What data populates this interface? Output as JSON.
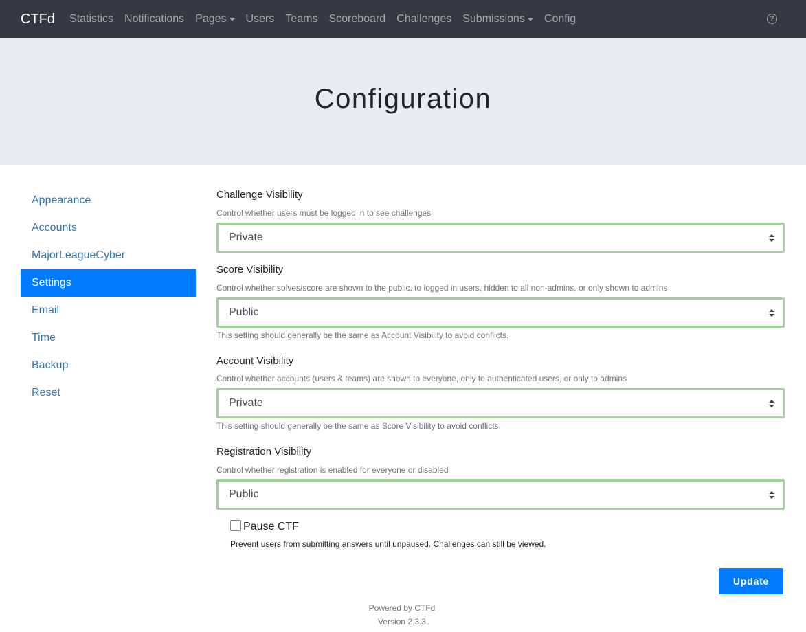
{
  "navbar": {
    "brand": "CTFd",
    "links": [
      {
        "label": "Statistics",
        "dropdown": false
      },
      {
        "label": "Notifications",
        "dropdown": false
      },
      {
        "label": "Pages",
        "dropdown": true
      },
      {
        "label": "Users",
        "dropdown": false
      },
      {
        "label": "Teams",
        "dropdown": false
      },
      {
        "label": "Scoreboard",
        "dropdown": false
      },
      {
        "label": "Challenges",
        "dropdown": false
      },
      {
        "label": "Submissions",
        "dropdown": true
      },
      {
        "label": "Config",
        "dropdown": false
      }
    ],
    "help_icon": "?"
  },
  "header": {
    "title": "Configuration"
  },
  "sidebar": {
    "items": [
      {
        "label": "Appearance"
      },
      {
        "label": "Accounts"
      },
      {
        "label": "MajorLeagueCyber"
      },
      {
        "label": "Settings",
        "active": true
      },
      {
        "label": "Email"
      },
      {
        "label": "Time"
      },
      {
        "label": "Backup"
      },
      {
        "label": "Reset"
      }
    ]
  },
  "settings": {
    "challenge_visibility": {
      "label": "Challenge Visibility",
      "help": "Control whether users must be logged in to see challenges",
      "value": "Private"
    },
    "score_visibility": {
      "label": "Score Visibility",
      "help": "Control whether solves/score are shown to the public, to logged in users, hidden to all non-admins, or only shown to admins",
      "value": "Public",
      "note": "This setting should generally be the same as Account Visibility to avoid conflicts."
    },
    "account_visibility": {
      "label": "Account Visibility",
      "help": "Control whether accounts (users & teams) are shown to everyone, only to authenticated users, or only to admins",
      "value": "Private",
      "note": "This setting should generally be the same as Score Visibility to avoid conflicts."
    },
    "registration_visibility": {
      "label": "Registration Visibility",
      "help": "Control whether registration is enabled for everyone or disabled",
      "value": "Public"
    },
    "pause": {
      "label": "Pause CTF",
      "checked": false,
      "help": "Prevent users from submitting answers until unpaused. Challenges can still be viewed."
    },
    "update_label": "Update"
  },
  "footer": {
    "powered": "Powered by CTFd",
    "version": "Version 2.3.3"
  },
  "colors": {
    "navbar_bg": "#343a40",
    "jumbotron_bg": "#e9ecef",
    "accent": "#007bff",
    "link": "#3277b3",
    "focus_border": "#a3d19c"
  }
}
